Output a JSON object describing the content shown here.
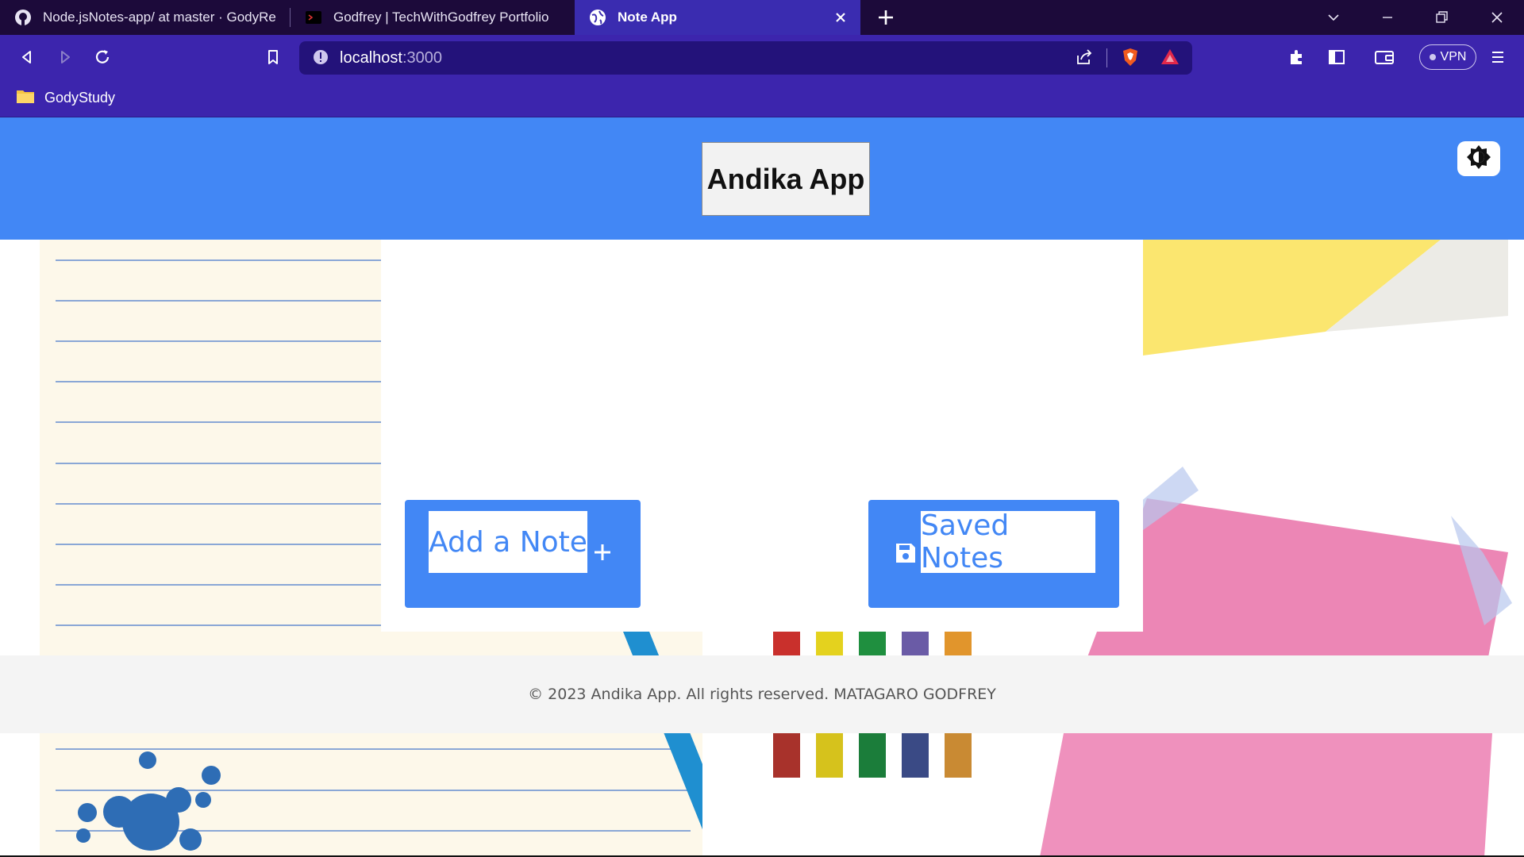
{
  "browser": {
    "tabs": [
      {
        "title": "Node.jsNotes-app/ at master · GodyRe",
        "icon": "github-icon"
      },
      {
        "title": "Godfrey | TechWithGodfrey Portfolio",
        "icon": "terminal-icon"
      },
      {
        "title": "Note App",
        "icon": "globe-icon",
        "active": true
      }
    ],
    "url_host": "localhost",
    "url_port": ":3000",
    "vpn_label": "VPN",
    "bookmarks": [
      {
        "label": "GodyStudy",
        "icon": "folder-icon"
      }
    ]
  },
  "app": {
    "brand": "Andika App",
    "buttons": {
      "add_note": "Add a Note",
      "saved_notes": "Saved Notes"
    },
    "footer": "© 2023 Andika App. All rights reserved. MATAGARO GODFREY"
  },
  "colors": {
    "header": "#4287f5",
    "browser_tabs": "#1c0a3a",
    "browser_toolbar": "#3c25ad",
    "active_tab": "#3a2cb0"
  }
}
